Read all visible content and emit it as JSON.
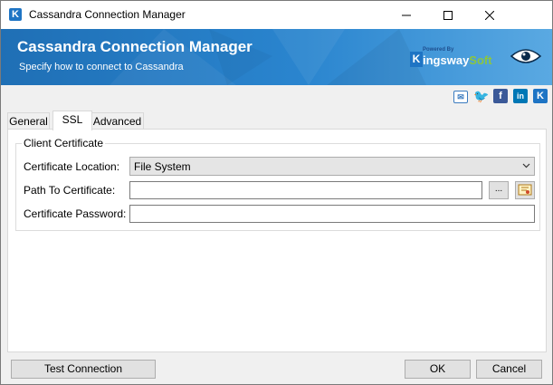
{
  "window": {
    "title": "Cassandra Connection Manager"
  },
  "banner": {
    "title": "Cassandra Connection Manager",
    "subtitle": "Specify how to connect to Cassandra",
    "brand_powered": "Powered By",
    "brand_name_1": "ingsway",
    "brand_name_2": "Soft",
    "brand_letter": "K"
  },
  "social": [
    "email-icon",
    "twitter-icon",
    "facebook-icon",
    "linkedin-icon",
    "kingswaysoft-icon"
  ],
  "tabs": [
    {
      "label": "General",
      "active": false
    },
    {
      "label": "SSL",
      "active": true
    },
    {
      "label": "Advanced",
      "active": false
    }
  ],
  "ssl": {
    "group_title": "Client Certificate",
    "location_label": "Certificate Location:",
    "location_value": "File System",
    "path_label": "Path To Certificate:",
    "path_value": "",
    "browse_label": "...",
    "password_label": "Certificate Password:",
    "password_value": ""
  },
  "buttons": {
    "test": "Test Connection",
    "ok": "OK",
    "cancel": "Cancel"
  },
  "colors": {
    "banner": "#2a85cf",
    "accent": "#1e74c4"
  }
}
